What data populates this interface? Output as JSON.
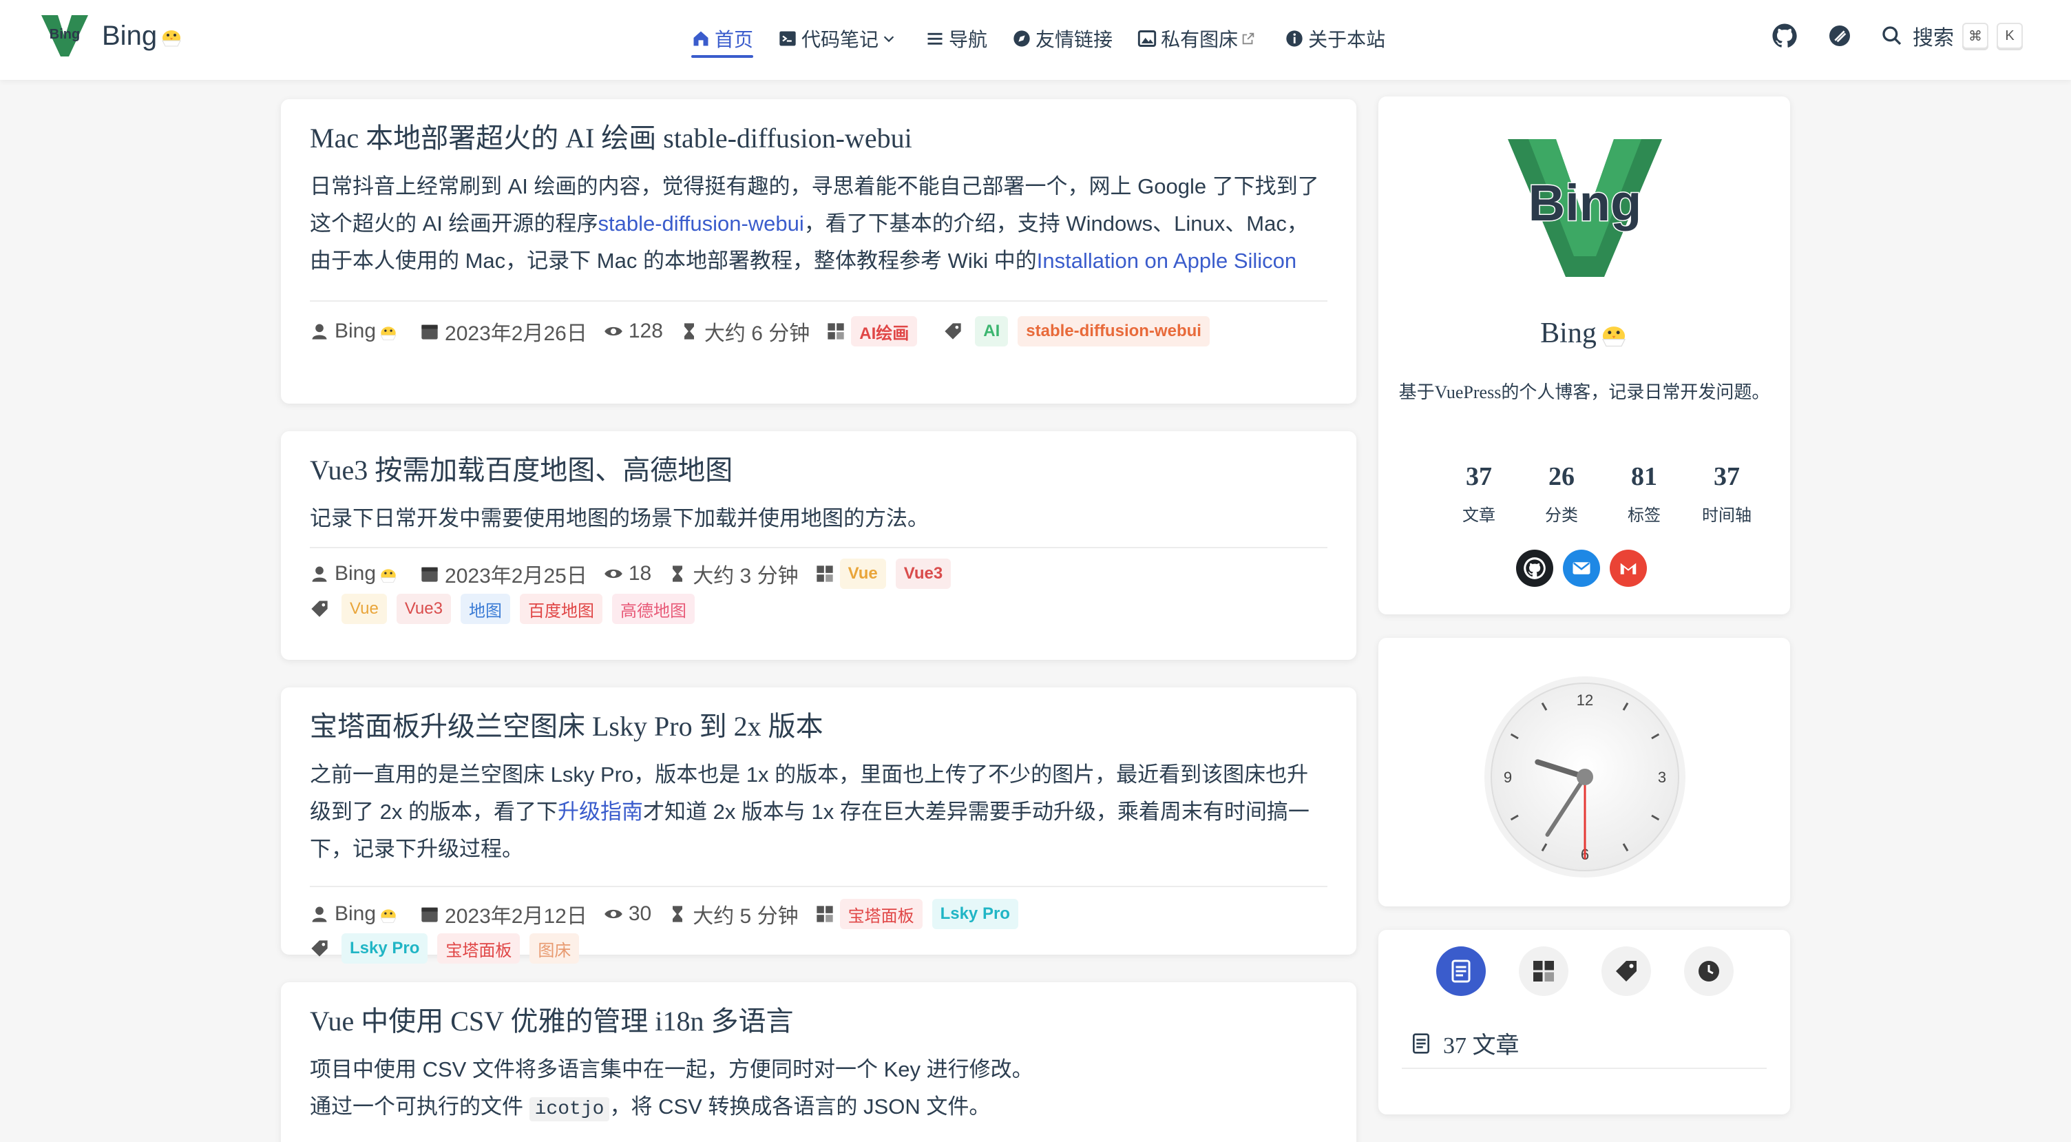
{
  "brand": {
    "name": "Bing",
    "logo_text": "Bing"
  },
  "nav": {
    "items": [
      {
        "label": "首页",
        "icon": "home-icon",
        "active": true
      },
      {
        "label": "代码笔记",
        "icon": "code-icon",
        "dropdown": true
      },
      {
        "label": "导航",
        "icon": "list-icon"
      },
      {
        "label": "友情链接",
        "icon": "compass-icon"
      },
      {
        "label": "私有图床",
        "icon": "image-icon",
        "external": true
      },
      {
        "label": "关于本站",
        "icon": "info-icon"
      }
    ],
    "search_label": "搜索",
    "kbd_cmd": "⌘",
    "kbd_k": "K"
  },
  "articles": [
    {
      "title": "Mac 本地部署超火的 AI 绘画 stable-diffusion-webui",
      "excerpt_1": "日常抖音上经常刷到 AI 绘画的内容，觉得挺有趣的，寻思着能不能自己部署一个，网上 Google 了下找到了这个超火的 AI 绘画开源的程序",
      "link_1": "stable-diffusion-webui",
      "excerpt_2": "，看了下基本的介绍，支持 Windows、Linux、Mac，由于本人使用的 Mac，记录下 Mac 的本地部署教程，整体教程参考 Wiki 中的",
      "link_2": "Installation on Apple Silicon",
      "author": "Bing",
      "date": "2023年2月26日",
      "views": "128",
      "read_time": "大约 6 分钟",
      "categories": [
        "AI绘画"
      ],
      "tags": [
        "AI",
        "stable-diffusion-webui"
      ]
    },
    {
      "title": "Vue3 按需加载百度地图、高德地图",
      "excerpt": "记录下日常开发中需要使用地图的场景下加载并使用地图的方法。",
      "author": "Bing",
      "date": "2023年2月25日",
      "views": "18",
      "read_time": "大约 3 分钟",
      "categories": [
        "Vue",
        "Vue3"
      ],
      "tags": [
        "Vue",
        "Vue3",
        "地图",
        "百度地图",
        "高德地图"
      ]
    },
    {
      "title": "宝塔面板升级兰空图床 Lsky Pro 到 2x 版本",
      "excerpt_1": "之前一直用的是兰空图床 Lsky Pro，版本也是 1x 的版本，里面也上传了不少的图片，最近看到该图床也升级到了 2x 的版本，看了下",
      "link_1": "升级指南",
      "excerpt_2": "才知道 2x 版本与 1x 存在巨大差异需要手动升级，乘着周末有时间搞一下，记录下升级过程。",
      "author": "Bing",
      "date": "2023年2月12日",
      "views": "30",
      "read_time": "大约 5 分钟",
      "categories": [
        "宝塔面板",
        "Lsky Pro"
      ],
      "tags": [
        "Lsky Pro",
        "宝塔面板",
        "图床"
      ]
    },
    {
      "title": "Vue 中使用 CSV 优雅的管理 i18n 多语言",
      "excerpt_1": "项目中使用 CSV 文件将多语言集中在一起，方便同时对一个 Key 进行修改。",
      "excerpt_2a": "通过一个可执行的文件 ",
      "code": "icotjo",
      "excerpt_2b": "，将 CSV 转换成各语言的 JSON 文件。"
    }
  ],
  "profile": {
    "name": "Bing",
    "description": "基于VuePress的个人博客，记录日常开发问题。",
    "stats": [
      {
        "num": "37",
        "label": "文章"
      },
      {
        "num": "26",
        "label": "分类"
      },
      {
        "num": "81",
        "label": "标签"
      },
      {
        "num": "37",
        "label": "时间轴"
      }
    ],
    "socials": [
      "github-icon",
      "email-icon",
      "gmail-icon"
    ]
  },
  "clock": {
    "hour": 9,
    "minute": 35,
    "second": 30
  },
  "side_tabs": {
    "items": [
      "article-icon",
      "category-icon",
      "tag-icon",
      "timeline-icon"
    ],
    "articles_count": "37 文章"
  },
  "colors": {
    "accent": "#3a5ccc",
    "logo_green": "#2e8a52",
    "logo_dark": "#2b3a4a"
  }
}
